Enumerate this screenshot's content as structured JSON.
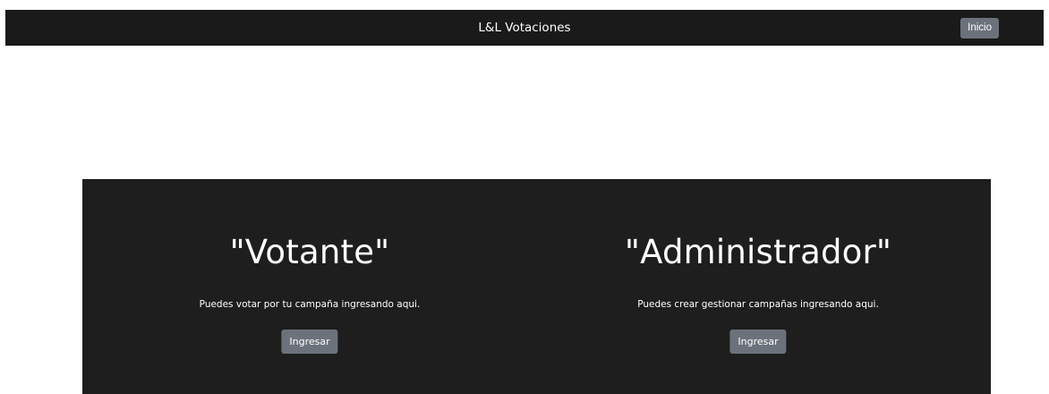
{
  "navbar": {
    "brand": "L&L Votaciones",
    "home_button": "Inicio"
  },
  "cards": [
    {
      "title": "\"Votante\"",
      "description": "Puedes votar por tu campaña ingresando aqui.",
      "button": "Ingresar"
    },
    {
      "title": "\"Administrador\"",
      "description": "Puedes crear gestionar campañas ingresando aqui.",
      "button": "Ingresar"
    }
  ],
  "colors": {
    "navbar_bg": "#1a1a1a",
    "panel_bg": "#1e1e1e",
    "button_bg": "#6c727b",
    "text": "#ffffff"
  }
}
